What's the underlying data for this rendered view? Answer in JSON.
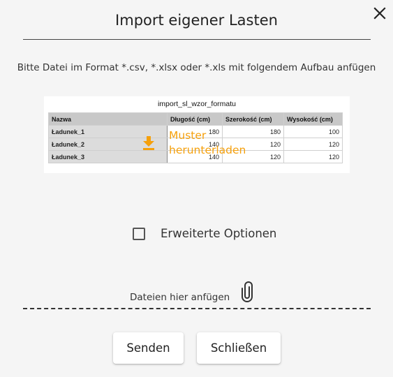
{
  "dialog": {
    "title": "Import eigener Lasten",
    "instruction": "Bitte Datei im Format *.csv, *.xlsx oder *.xls mit folgendem Aufbau anfügen"
  },
  "sample": {
    "file_title": "import_sl_wzor_formatu",
    "headers": [
      "Nazwa",
      "Długość (cm)",
      "Szerokość (cm)",
      "Wysokość (cm)"
    ],
    "rows": [
      [
        "Ładunek_1",
        "180",
        "180",
        "100"
      ],
      [
        "Ładunek_2",
        "140",
        "120",
        "120"
      ],
      [
        "Ładunek_3",
        "140",
        "120",
        "120"
      ]
    ],
    "download_label_line1": "Muster",
    "download_label_line2": "herunterladen"
  },
  "options": {
    "advanced_label": "Erweiterte Optionen",
    "advanced_checked": false
  },
  "dropzone": {
    "label": "Dateien hier anfügen"
  },
  "buttons": {
    "send": "Senden",
    "close": "Schließen"
  },
  "colors": {
    "accent": "#f5a00c",
    "background": "#f5f5f5"
  },
  "icons": {
    "close": "close-icon",
    "download": "download-icon",
    "attach": "paperclip-icon"
  }
}
